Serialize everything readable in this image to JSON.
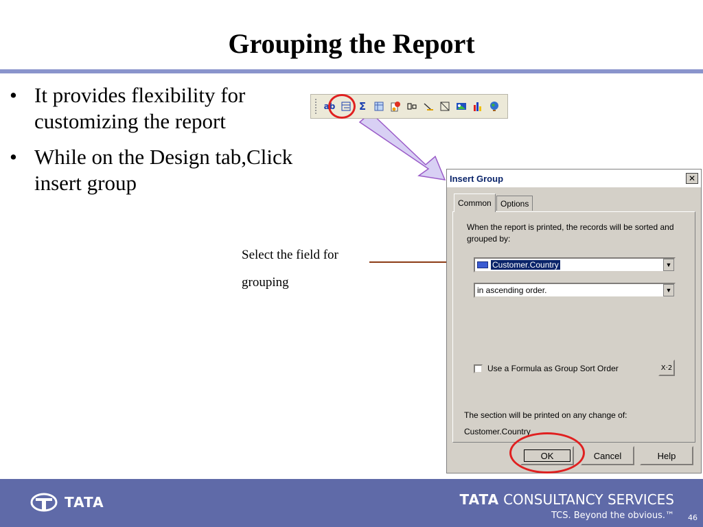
{
  "slide": {
    "title": "Grouping the Report",
    "bullets": [
      "It provides flexibility for customizing the report",
      "While on the Design tab,Click insert group"
    ],
    "bullet_glyph": "•",
    "callout_line1": "Select the field for",
    "callout_line2": "grouping"
  },
  "toolbar": {
    "icons": [
      "text-object-icon",
      "insert-group-icon",
      "summary-sigma-icon",
      "cross-tab-icon",
      "ole-object-icon",
      "field-object-icon",
      "line-icon",
      "box-icon",
      "picture-icon",
      "chart-icon",
      "map-icon"
    ],
    "text_object_label": "ab",
    "sigma_label": "Σ"
  },
  "dialog": {
    "title": "Insert Group",
    "close_label": "✕",
    "tabs": [
      "Common",
      "Options"
    ],
    "instruction": "When the report is printed, the records will be sorted and grouped by:",
    "group_field": "Customer.Country",
    "sort_order": "in ascending order.",
    "formula_checkbox_label": "Use a Formula as Group Sort Order",
    "formula_button_label": "X·2",
    "section_note": "The section will be printed on any change of:",
    "section_field": "Customer.Country",
    "buttons": {
      "ok": "OK",
      "cancel": "Cancel",
      "help": "Help"
    }
  },
  "footer": {
    "left_brand": "TATA",
    "right_brand_bold": "TATA",
    "right_brand": "CONSULTANCY SERVICES",
    "tagline": "TCS. Beyond the obvious.™",
    "page_number": "46"
  },
  "colors": {
    "title_rule": "#8a94cc",
    "footer_bg": "#5f6aa8",
    "highlight_red": "#e02020",
    "arrow_fill": "#d8d0f4",
    "arrow_stroke": "#9a5bc8",
    "pointer_line": "#8b3a14"
  }
}
